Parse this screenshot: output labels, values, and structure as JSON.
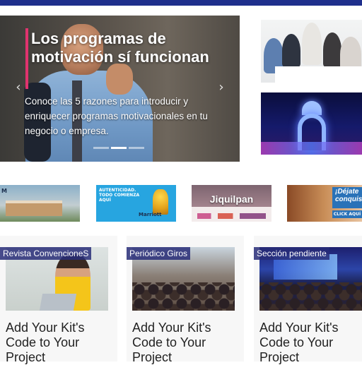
{
  "colors": {
    "topbar": "#1f2f8c",
    "accent_bar": "#e0336e",
    "badge_bg": "#2d3278"
  },
  "hero": {
    "title": "Los programas de motivación sí funcionan",
    "subtitle": "Conoce las 5 razones para introducir y enriquecer programas motivacionales en tu negocio o empresa.",
    "prev_icon": "‹",
    "next_icon": "›",
    "slide_count": 3,
    "active_slide": 2
  },
  "banners": {
    "autenticidad": {
      "line1": "AUTENTICIDAD.",
      "line2": "TODO COMIENZA AQUÍ",
      "logo": "Marriott"
    },
    "marriott_hotel": {
      "logo": "M"
    },
    "jiquilpan": {
      "label": "Jiquilpan"
    },
    "conquistar": {
      "text": "¡Déjate conquistar!",
      "cta": "CLICK AQUÍ"
    }
  },
  "cards": [
    {
      "badge": "Revista ConvencioneS",
      "title": "Add Your Kit's Code to Your Project"
    },
    {
      "badge": "Periódico Giros",
      "title": "Add Your Kit's Code to Your Project"
    },
    {
      "badge": "Sección pendiente",
      "title": "Add Your Kit's Code to Your Project"
    }
  ]
}
